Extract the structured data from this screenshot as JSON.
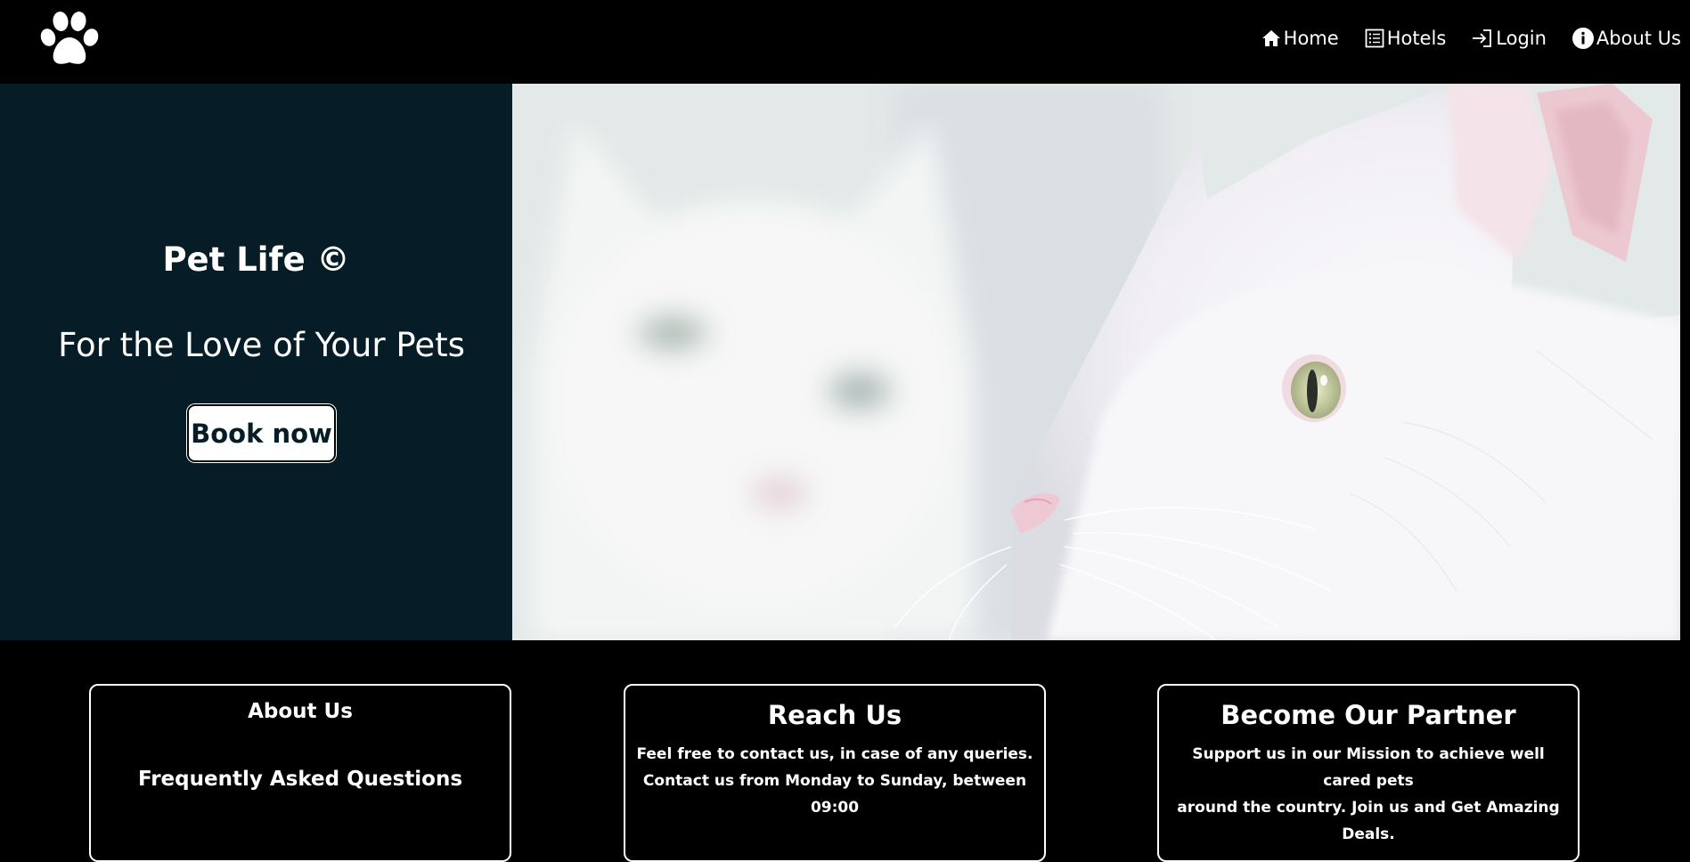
{
  "nav": {
    "logo_icon": "paw-icon",
    "links": [
      {
        "label": "Home",
        "icon": "home-icon"
      },
      {
        "label": "Hotels",
        "icon": "list-icon"
      },
      {
        "label": "Login",
        "icon": "login-icon"
      },
      {
        "label": "About Us",
        "icon": "info-icon"
      }
    ]
  },
  "hero": {
    "title": "Pet Life ©",
    "tagline": "For the Love of Your Pets",
    "cta_label": "Book now",
    "background_color": "#061c26",
    "image_subject": "two white cats"
  },
  "cards": [
    {
      "title": "About Us",
      "subtitle": "Frequently Asked Questions"
    },
    {
      "title": "Reach Us",
      "lines": [
        "Feel free to contact us, in case of any queries.",
        "Contact us from Monday to Sunday, between 09:00"
      ]
    },
    {
      "title": "Become Our Partner",
      "lines": [
        "Support us in our Mission to achieve well cared pets",
        "around the country. Join us and Get Amazing Deals."
      ]
    }
  ]
}
